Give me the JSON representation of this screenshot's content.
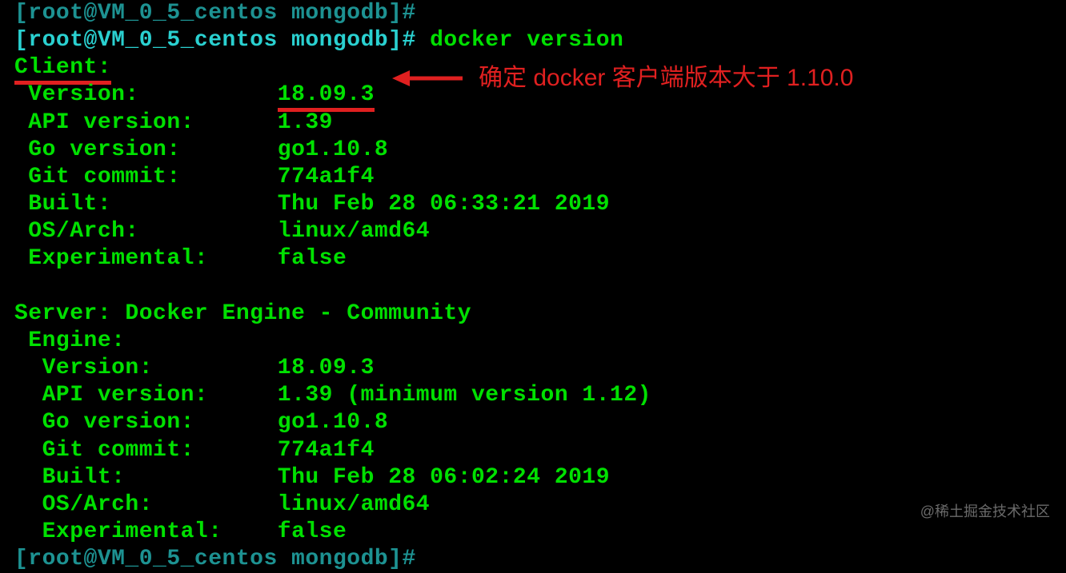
{
  "prompt_cut": "[root@VM_0_5_centos mongodb]#",
  "prompt_user": "[root@VM_0_5_centos mongodb]# ",
  "command": "docker version",
  "client": {
    "header": "Client:",
    "rows": [
      {
        "label": " Version:          ",
        "value": "18.09.3"
      },
      {
        "label": " API version:      ",
        "value": "1.39"
      },
      {
        "label": " Go version:       ",
        "value": "go1.10.8"
      },
      {
        "label": " Git commit:       ",
        "value": "774a1f4"
      },
      {
        "label": " Built:            ",
        "value": "Thu Feb 28 06:33:21 2019"
      },
      {
        "label": " OS/Arch:          ",
        "value": "linux/amd64"
      },
      {
        "label": " Experimental:     ",
        "value": "false"
      }
    ]
  },
  "server": {
    "header": "Server: Docker Engine - Community",
    "engine_label": " Engine:",
    "rows": [
      {
        "label": "  Version:         ",
        "value": "18.09.3"
      },
      {
        "label": "  API version:     ",
        "value": "1.39 (minimum version 1.12)"
      },
      {
        "label": "  Go version:      ",
        "value": "go1.10.8"
      },
      {
        "label": "  Git commit:      ",
        "value": "774a1f4"
      },
      {
        "label": "  Built:           ",
        "value": "Thu Feb 28 06:02:24 2019"
      },
      {
        "label": "  OS/Arch:         ",
        "value": "linux/amd64"
      },
      {
        "label": "  Experimental:    ",
        "value": "false"
      }
    ]
  },
  "prompt_bottom_cut": "[root@VM_0_5_centos mongodb]#",
  "annotation_text": "确定 docker 客户端版本大于 1.10.0",
  "watermark": "@稀土掘金技术社区"
}
